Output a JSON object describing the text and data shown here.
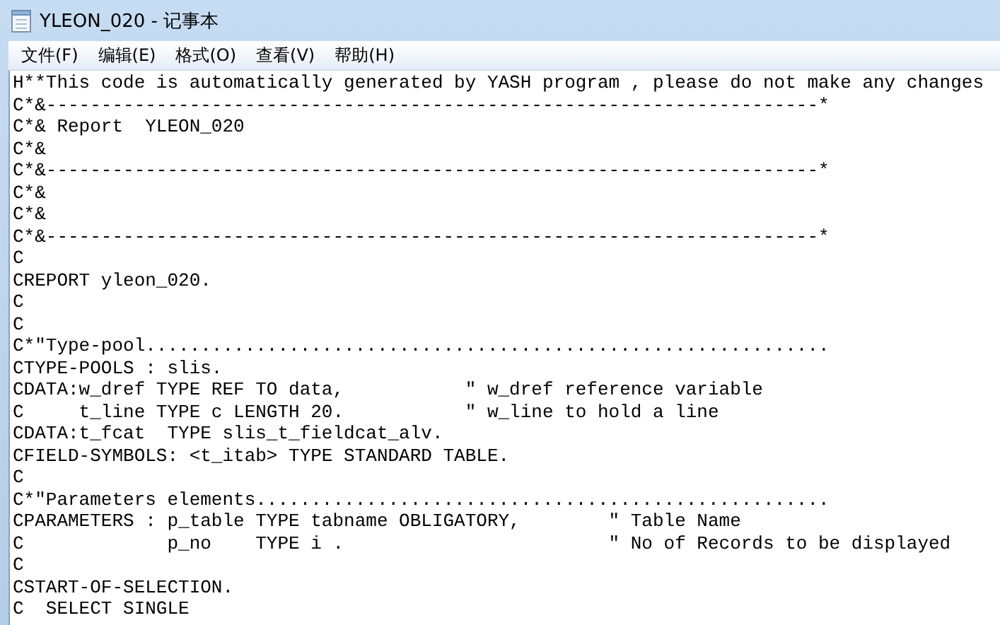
{
  "window": {
    "title": "YLEON_020 - 记事本"
  },
  "menu": [
    "文件(F)",
    "编辑(E)",
    "格式(O)",
    "查看(V)",
    "帮助(H)"
  ],
  "editor": {
    "lines": [
      "H**This code is automatically generated by YASH program , please do not make any changes",
      "C*&----------------------------------------------------------------------*",
      "C*& Report  YLEON_020",
      "C*&",
      "C*&----------------------------------------------------------------------*",
      "C*&",
      "C*&",
      "C*&----------------------------------------------------------------------*",
      "C",
      "CREPORT yleon_020.",
      "C",
      "C",
      "C*\"Type-pool..............................................................",
      "CTYPE-POOLS : slis.",
      "CDATA:w_dref TYPE REF TO data,           \" w_dref reference variable",
      "C     t_line TYPE c LENGTH 20.           \" w_line to hold a line",
      "CDATA:t_fcat  TYPE slis_t_fieldcat_alv.",
      "CFIELD-SYMBOLS: <t_itab> TYPE STANDARD TABLE.",
      "C",
      "C*\"Parameters elements....................................................",
      "CPARAMETERS : p_table TYPE tabname OBLIGATORY,        \" Table Name",
      "C             p_no    TYPE i .                        \" No of Records to be displayed",
      "C",
      "CSTART-OF-SELECTION.",
      "C  SELECT SINGLE"
    ]
  }
}
